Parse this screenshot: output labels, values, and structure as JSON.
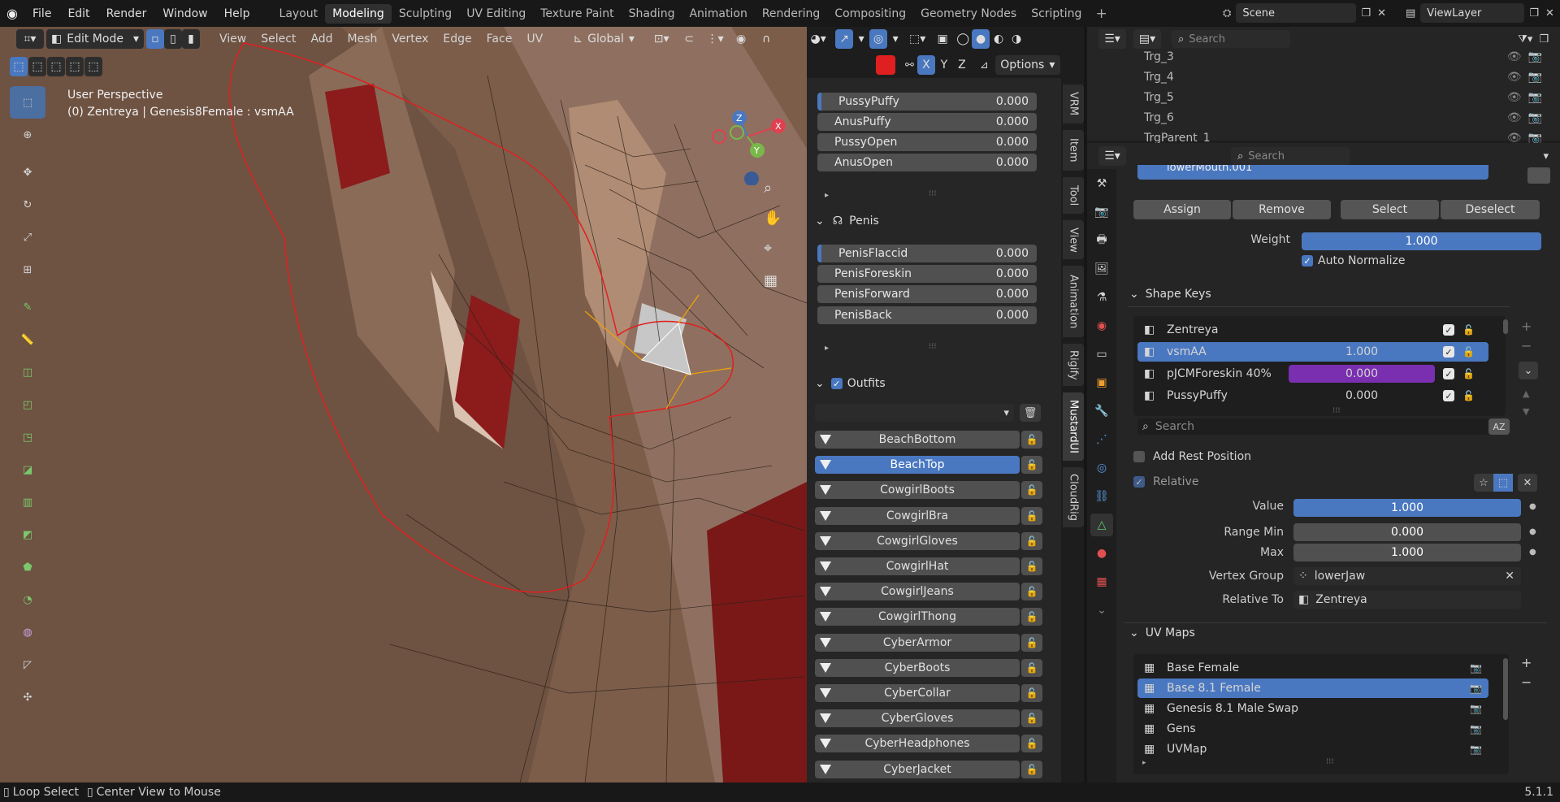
{
  "menu": {
    "file": "File",
    "edit": "Edit",
    "render": "Render",
    "window": "Window",
    "help": "Help"
  },
  "workspaces": [
    "Layout",
    "Modeling",
    "Sculpting",
    "UV Editing",
    "Texture Paint",
    "Shading",
    "Animation",
    "Rendering",
    "Compositing",
    "Geometry Nodes",
    "Scripting"
  ],
  "active_workspace": "Modeling",
  "scene": "Scene",
  "view_layer": "ViewLayer",
  "viewport_header": {
    "mode": "Edit Mode",
    "menus": [
      "View",
      "Select",
      "Add",
      "Mesh",
      "Vertex",
      "Edge",
      "Face",
      "UV"
    ],
    "transform_orientation": "Global",
    "axes": [
      "X",
      "Y",
      "Z"
    ],
    "options": "Options"
  },
  "viewport": {
    "perspective": "User Perspective",
    "object_info": "(0) Zentreya | Genesis8Female : vsmAA"
  },
  "npanel": {
    "rows1": [
      {
        "label": "PussyPuffy",
        "value": "0.000"
      },
      {
        "label": "AnusPuffy",
        "value": "0.000"
      },
      {
        "label": "PussyOpen",
        "value": "0.000"
      },
      {
        "label": "AnusOpen",
        "value": "0.000"
      }
    ],
    "penis_header": "Penis",
    "rows2": [
      {
        "label": "PenisFlaccid",
        "value": "0.000"
      },
      {
        "label": "PenisForeskin",
        "value": "0.000"
      },
      {
        "label": "PenisForward",
        "value": "0.000"
      },
      {
        "label": "PenisBack",
        "value": "0.000"
      }
    ],
    "outfits_header": "Outfits",
    "outfits": [
      "BeachBottom",
      "BeachTop",
      "CowgirlBoots",
      "CowgirlBra",
      "CowgirlGloves",
      "CowgirlHat",
      "CowgirlJeans",
      "CowgirlThong",
      "CyberArmor",
      "CyberBoots",
      "CyberCollar",
      "CyberGloves",
      "CyberHeadphones",
      "CyberJacket"
    ],
    "selected_outfit": "BeachTop",
    "tabs": [
      "VRM",
      "Item",
      "Tool",
      "View",
      "Animation",
      "Rigify",
      "MustardUI",
      "CloudRig"
    ]
  },
  "outliner": {
    "search_placeholder": "Search",
    "items": [
      "Trg_3",
      "Trg_4",
      "Trg_5",
      "Trg_6",
      "TrgParent_1"
    ]
  },
  "properties": {
    "search_placeholder": "Search",
    "vertex_group_active": "lowerMouth.001",
    "buttons": {
      "assign": "Assign",
      "remove": "Remove",
      "select": "Select",
      "deselect": "Deselect"
    },
    "weight_label": "Weight",
    "weight_value": "1.000",
    "auto_normalize": "Auto Normalize",
    "shape_keys_header": "Shape Keys",
    "shape_keys": [
      {
        "name": "Zentreya",
        "value": ""
      },
      {
        "name": "vsmAA",
        "value": "1.000"
      },
      {
        "name": "pJCMForeskin 40%",
        "value": "0.000"
      },
      {
        "name": "PussyPuffy",
        "value": "0.000"
      }
    ],
    "shape_search_placeholder": "Search",
    "add_rest_position": "Add Rest Position",
    "relative": "Relative",
    "value_label": "Value",
    "value": "1.000",
    "range_min_label": "Range Min",
    "range_min": "0.000",
    "max_label": "Max",
    "max": "1.000",
    "vertex_group_label": "Vertex Group",
    "vertex_group": "lowerJaw",
    "relative_to_label": "Relative To",
    "relative_to": "Zentreya",
    "uv_maps_header": "UV Maps",
    "uv_maps": [
      "Base Female",
      "Base 8.1 Female",
      "Genesis 8.1 Male Swap",
      "Gens",
      "UVMap"
    ],
    "selected_uv": "Base 8.1 Female"
  },
  "statusbar": {
    "left1": "Loop Select",
    "left2": "Center View to Mouse",
    "version": "5.1.1"
  },
  "colors": {
    "accent": "#4a78c0",
    "violet": "#7a2fb0",
    "skin": "#8b6a55",
    "red": "#8c1c1c"
  }
}
